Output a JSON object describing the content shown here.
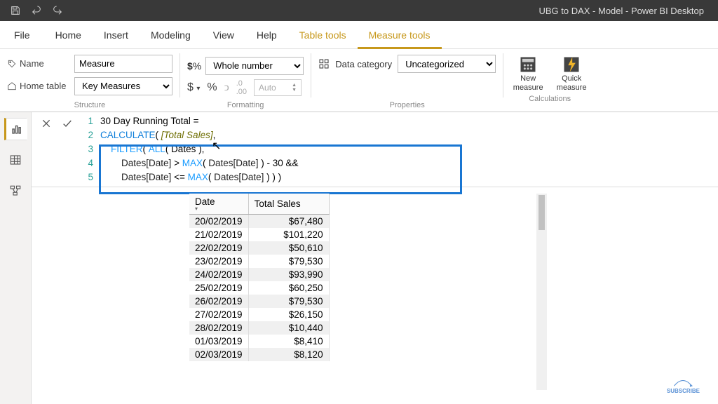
{
  "title_bar": {
    "app_title": "UBG to DAX - Model - Power BI Desktop"
  },
  "tabs": {
    "file": "File",
    "home": "Home",
    "insert": "Insert",
    "modeling": "Modeling",
    "view": "View",
    "help": "Help",
    "table_tools": "Table tools",
    "measure_tools": "Measure tools"
  },
  "structure": {
    "name_label": "Name",
    "name_value": "Measure",
    "hometable_label": "Home table",
    "hometable_value": "Key Measures",
    "group": "Structure"
  },
  "formatting": {
    "datatype": "Whole number",
    "auto": "Auto",
    "group": "Formatting"
  },
  "properties": {
    "label": "Data category",
    "value": "Uncategorized",
    "group": "Properties"
  },
  "calculations": {
    "new_measure": "New measure",
    "quick_measure": "Quick measure",
    "group": "Calculations"
  },
  "formula": {
    "l1_a": "30 Day Running Total",
    "l1_b": " = ",
    "l2_fn": "CALCULATE",
    "l2_a": "( ",
    "l2_ref": "[Total Sales]",
    "l2_b": ",",
    "l3_pad": "    ",
    "l3_fn": "FILTER",
    "l3_a": "( ",
    "l3_fn2": "ALL",
    "l3_b": "( Dates ),",
    "l4_pad": "        ",
    "l4_col1": "Dates[Date]",
    "l4_a": " > ",
    "l4_fn": "MAX",
    "l4_b": "( ",
    "l4_col2": "Dates[Date]",
    "l4_c": " ) - 30 &&",
    "l5_pad": "        ",
    "l5_col1": "Dates[Date]",
    "l5_a": " <= ",
    "l5_fn": "MAX",
    "l5_b": "( ",
    "l5_col2": "Dates[Date]",
    "l5_c": " ) ) )"
  },
  "table": {
    "headers": {
      "date": "Date",
      "sales": "Total Sales"
    },
    "rows": [
      {
        "date": "20/02/2019",
        "sales": "$67,480"
      },
      {
        "date": "21/02/2019",
        "sales": "$101,220"
      },
      {
        "date": "22/02/2019",
        "sales": "$50,610"
      },
      {
        "date": "23/02/2019",
        "sales": "$79,530"
      },
      {
        "date": "24/02/2019",
        "sales": "$93,990"
      },
      {
        "date": "25/02/2019",
        "sales": "$60,250"
      },
      {
        "date": "26/02/2019",
        "sales": "$79,530"
      },
      {
        "date": "27/02/2019",
        "sales": "$26,150"
      },
      {
        "date": "28/02/2019",
        "sales": "$10,440"
      },
      {
        "date": "01/03/2019",
        "sales": "$8,410"
      },
      {
        "date": "02/03/2019",
        "sales": "$8,120"
      }
    ]
  },
  "hint": "SUBSCRIBE"
}
